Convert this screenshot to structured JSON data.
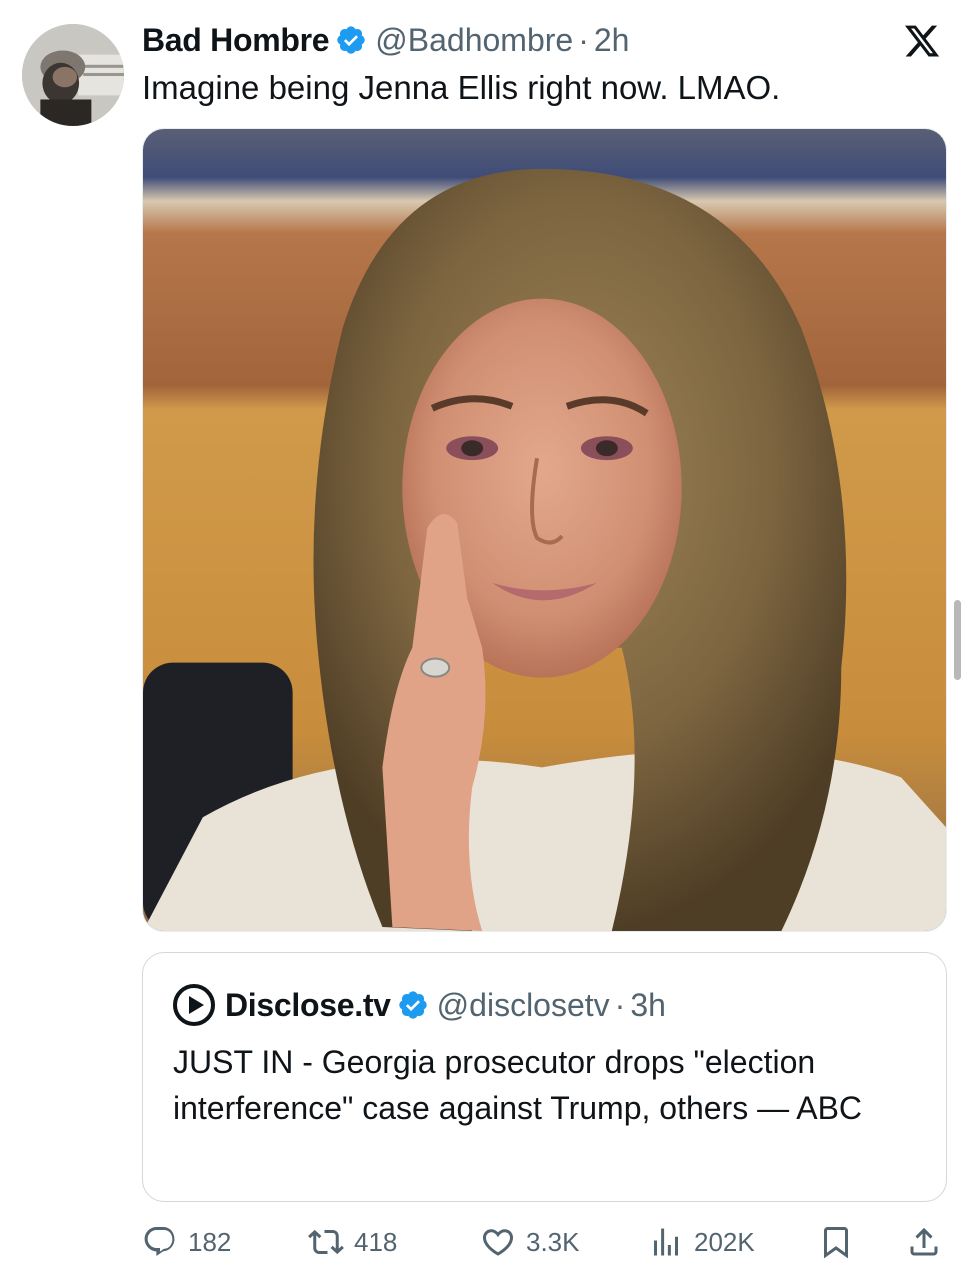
{
  "tweet": {
    "author_name": "Bad Hombre",
    "author_handle": "@Badhombre",
    "separator": "·",
    "time": "2h",
    "text": "Imagine being Jenna Ellis right now. LMAO.",
    "avatar_icon": "profile-photo",
    "verified_icon": "verified-badge-icon",
    "platform_logo": "x-logo-icon"
  },
  "quoted_tweet": {
    "author_name": "Disclose.tv",
    "author_handle": "@disclosetv",
    "separator": "·",
    "time": "3h",
    "text": "JUST IN - Georgia prosecutor drops \"election interference\" case against Trump, others — ABC",
    "logo_icon": "disclose-play-logo"
  },
  "actions": {
    "replies": "182",
    "reposts": "418",
    "likes": "3.3K",
    "views": "202K"
  },
  "colors": {
    "text_primary": "#0f1419",
    "text_secondary": "#536471",
    "verified_blue": "#1d9bf0",
    "border": "#cfd9de"
  }
}
